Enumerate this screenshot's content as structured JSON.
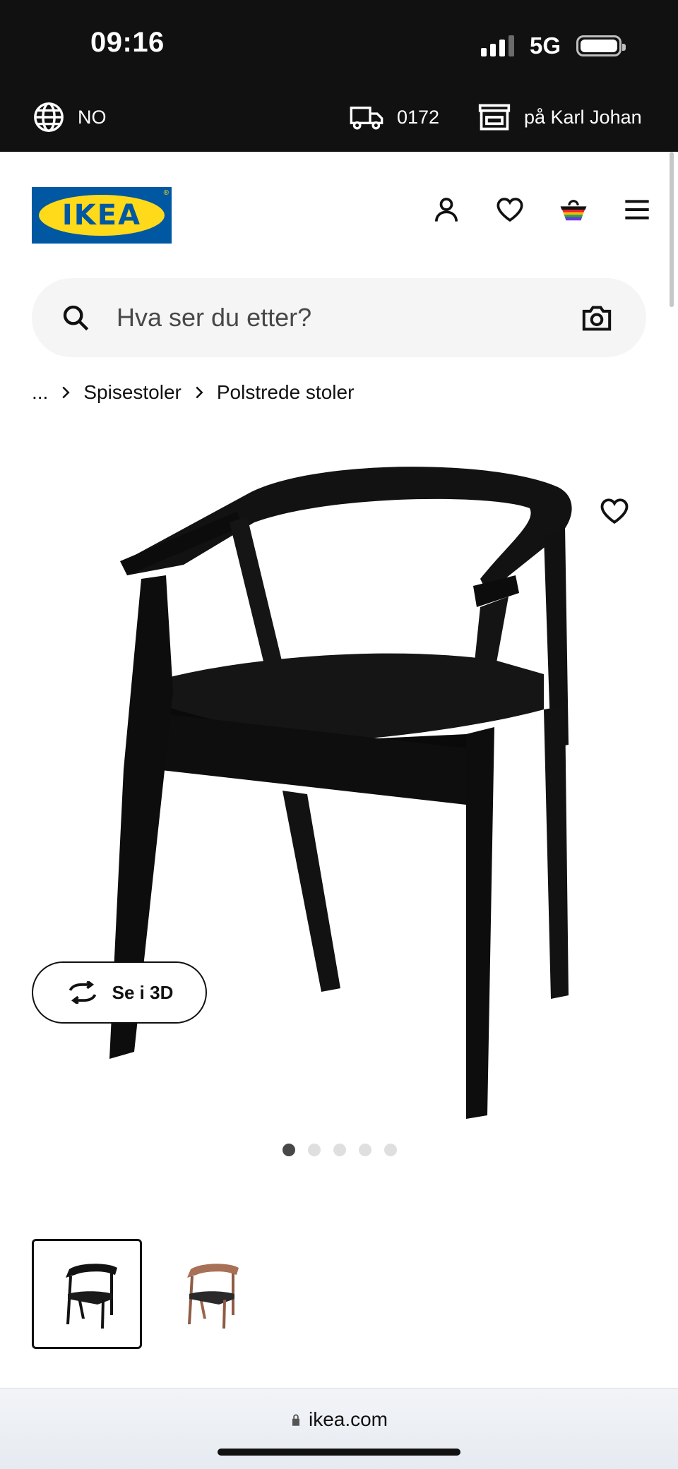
{
  "status_bar": {
    "time": "09:16",
    "network": "5G"
  },
  "utility_bar": {
    "language": "NO",
    "delivery_postcode": "0172",
    "store": "på Karl Johan"
  },
  "header": {
    "logo_text": "IKEA",
    "icons": [
      "profile-icon",
      "heart-icon",
      "basket-icon",
      "menu-icon"
    ]
  },
  "search": {
    "placeholder": "Hva ser du etter?"
  },
  "breadcrumb": {
    "ellipsis": "...",
    "items": [
      "Spisestoler",
      "Polstrede stoler"
    ]
  },
  "product": {
    "view_3d_label": "Se i 3D",
    "image_count": 5,
    "active_image": 1,
    "thumbnails": [
      {
        "variant": "black",
        "selected": true
      },
      {
        "variant": "brown",
        "selected": false
      }
    ]
  },
  "browser": {
    "url": "ikea.com"
  },
  "colors": {
    "brand_blue": "#0058a3",
    "brand_yellow": "#ffda1a",
    "dark": "#111111"
  }
}
